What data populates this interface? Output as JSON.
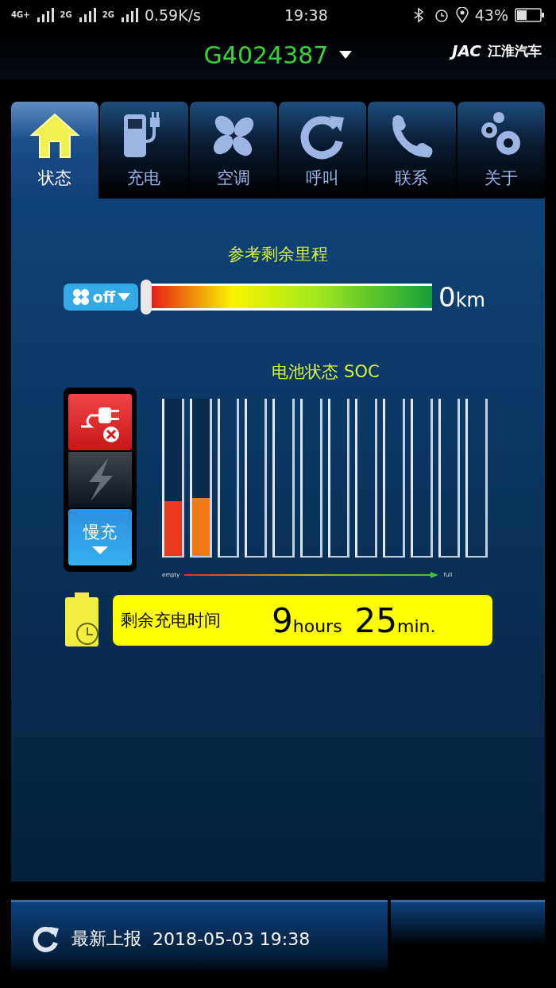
{
  "status_bar": {
    "signal_labels": [
      "4G+",
      "2G",
      "2G"
    ],
    "speed": "0.59K/s",
    "time": "19:38",
    "battery": "43%"
  },
  "header": {
    "vehicle": "G4024387",
    "brand": "JAC",
    "brand_name": "江淮汽车"
  },
  "tabs": [
    {
      "kind": "home",
      "label": "状态",
      "selected": true
    },
    {
      "kind": "fuel",
      "label": "充电",
      "selected": false
    },
    {
      "kind": "fan",
      "label": "空调",
      "selected": false
    },
    {
      "kind": "refresh",
      "label": "呼叫",
      "selected": false
    },
    {
      "kind": "phone",
      "label": "联系",
      "selected": false
    },
    {
      "kind": "gears",
      "label": "关于",
      "selected": false
    }
  ],
  "range": {
    "title": "参考剩余里程",
    "ac_label": "off",
    "level": 0,
    "value": "0",
    "unit": "km"
  },
  "charge_mode": {
    "unplugged": true,
    "charging": false,
    "mode": "慢充"
  },
  "soc": {
    "title": "电池状态 SOC",
    "empty_label": "empty",
    "full_label": "full",
    "cells": [
      {
        "filled": true,
        "level": 0.35,
        "color": "#e8391e"
      },
      {
        "filled": true,
        "level": 0.37,
        "color": "#f07a14"
      },
      {
        "filled": false
      },
      {
        "filled": false
      },
      {
        "filled": false
      },
      {
        "filled": false
      },
      {
        "filled": false
      },
      {
        "filled": false
      },
      {
        "filled": false
      },
      {
        "filled": false
      },
      {
        "filled": false
      },
      {
        "filled": false
      }
    ]
  },
  "charge_time": {
    "label": "剩余充电时间",
    "hours": "9",
    "hours_unit": "hours",
    "minutes": "25",
    "minutes_unit": "min."
  },
  "footer": {
    "label": "最新上报",
    "timestamp": "2018-05-03 19:38"
  }
}
